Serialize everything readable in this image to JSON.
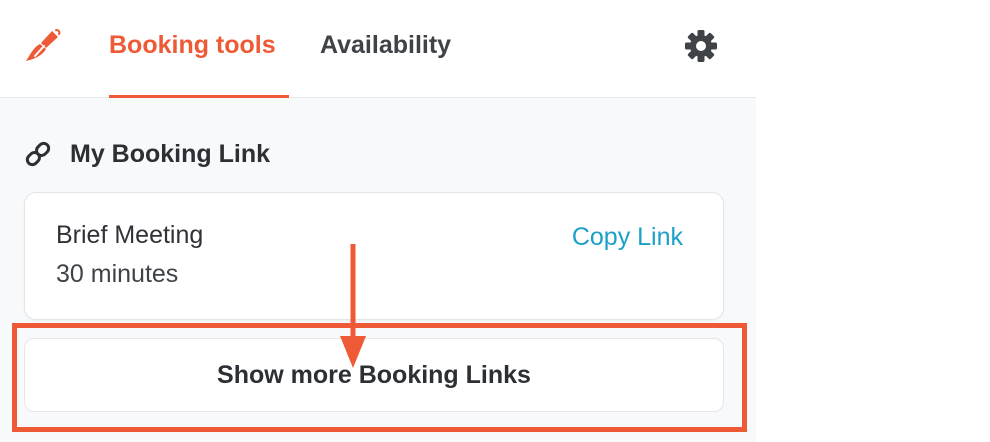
{
  "header": {
    "tabs": [
      {
        "label": "Booking tools",
        "active": true
      },
      {
        "label": "Availability",
        "active": false
      }
    ],
    "logo_icon": "brush-logo-icon",
    "settings_icon": "gear-icon"
  },
  "booking_section": {
    "heading": "My Booking Link",
    "heading_icon": "link-icon",
    "card": {
      "title": "Brief Meeting",
      "duration": "30 minutes",
      "action_label": "Copy Link"
    },
    "show_more_label": "Show more Booking Links"
  },
  "annotation": {
    "color": "#ee5a35"
  },
  "colors": {
    "accent": "#ee5a35",
    "link": "#1ba0c8",
    "text_dark": "#2c2f33",
    "panel_bg": "#f8f9fb"
  }
}
